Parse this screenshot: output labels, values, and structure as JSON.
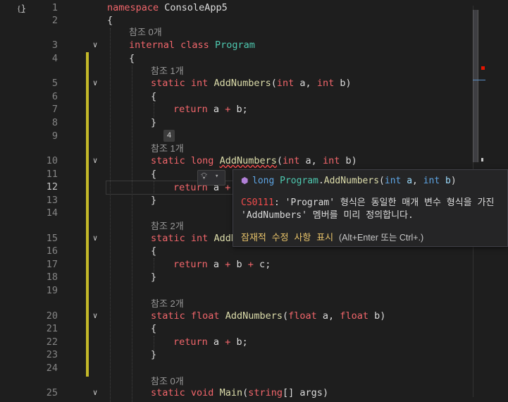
{
  "colors": {
    "background": "#1e1e1e",
    "keyword": "#f2666b",
    "type_keyword": "#5ea6e6",
    "class_name": "#4ec9b0",
    "method": "#dcdcaa",
    "parameter": "#9cdcfe",
    "modified_margin": "#e2d52c",
    "error": "#f14c4c",
    "quick_action_link": "#e9c46a"
  },
  "icons": {
    "corner": "scope-braces-icon",
    "fold": "chevron-down-icon",
    "lightbulb": "lightbulb-icon",
    "tooltip_symbol": "method-cube-icon"
  },
  "editor": {
    "current_line": "12",
    "line_numbers": [
      "1",
      "2",
      "3",
      "4",
      "5",
      "6",
      "7",
      "8",
      "9",
      "10",
      "11",
      "12",
      "13",
      "14",
      "15",
      "16",
      "17",
      "18",
      "19",
      "20",
      "21",
      "22",
      "23",
      "24",
      "25"
    ],
    "code_lens": {
      "program": "참조 0개",
      "add1": "참조 1개",
      "add2": "참조 1개",
      "add3": "참조 2개",
      "add4": "참조 2개",
      "main": "참조 0개"
    },
    "tokens": {
      "namespace_kw": "namespace",
      "namespace_name": "ConsoleApp5",
      "open_brace": "{",
      "close_brace": "}",
      "internal_kw": "internal",
      "class_kw": "class",
      "class_name": "Program",
      "static_kw": "static",
      "int_kw": "int",
      "long_kw": "long",
      "float_kw": "float",
      "void_kw": "void",
      "string_kw": "string",
      "return_kw": "return",
      "method_name": "AddNumbers",
      "main_name": "Main",
      "main_partial": "AddN",
      "param_a": "a",
      "param_b": "b",
      "param_c": "c",
      "param_args": "args",
      "plus": "+",
      "comma": ",",
      "open_paren": "(",
      "close_paren": ")",
      "semicolon": ";",
      "brackets": "[]"
    },
    "inline_hint": "4"
  },
  "tooltip": {
    "sig_return_type": "long",
    "sig_class": "Program",
    "sig_dot": ".",
    "sig_method": "AddNumbers",
    "sig_open": "(",
    "sig_type_a": "int",
    "sig_param_a": "a",
    "sig_comma": ",",
    "sig_type_b": "int",
    "sig_param_b": "b",
    "sig_close": ")",
    "error_code": "CS0111",
    "error_message": ": 'Program' 형식은 동일한 매개 변수 형식을 가진 'AddNumbers' 멤버를 미리 정의합니다.",
    "quick_fix_link": "잠재적 수정 사항 표시",
    "quick_fix_hint": "(Alt+Enter 또는 Ctrl+.)"
  }
}
